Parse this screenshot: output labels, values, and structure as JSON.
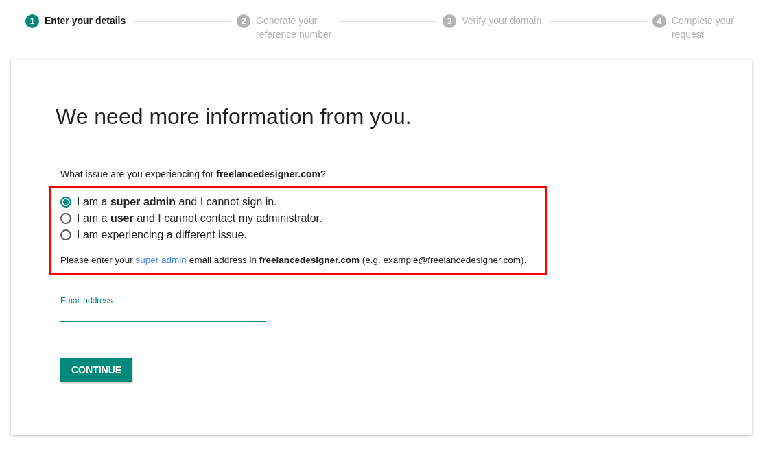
{
  "steps": [
    {
      "number": "1",
      "lines": [
        "Enter your details"
      ],
      "selected": true
    },
    {
      "number": "2",
      "lines": [
        "Generate your",
        "reference number"
      ],
      "selected": false
    },
    {
      "number": "3",
      "lines": [
        "Verify your domain"
      ],
      "selected": false
    },
    {
      "number": "4",
      "lines": [
        "Complete your",
        "request"
      ],
      "selected": false
    }
  ],
  "heading": "We need more information from you.",
  "question": "What issue are you experiencing for **freelancedesigner.com**?",
  "options": [
    {
      "label": "I am a **super admin** and I cannot sign in.",
      "selected": true
    },
    {
      "label": "I am a **user** and I cannot contact my administrator.",
      "selected": false
    },
    {
      "label": "I am experiencing a different issue.",
      "selected": false
    }
  ],
  "help": {
    "before": "Please enter your",
    "link": "super admin",
    "after": "email address in **freelancedesigner.com** (e.g. example@freelancedesigner.com)."
  },
  "email_field": {
    "label": "Email address"
  },
  "button": "CONTINUE"
}
